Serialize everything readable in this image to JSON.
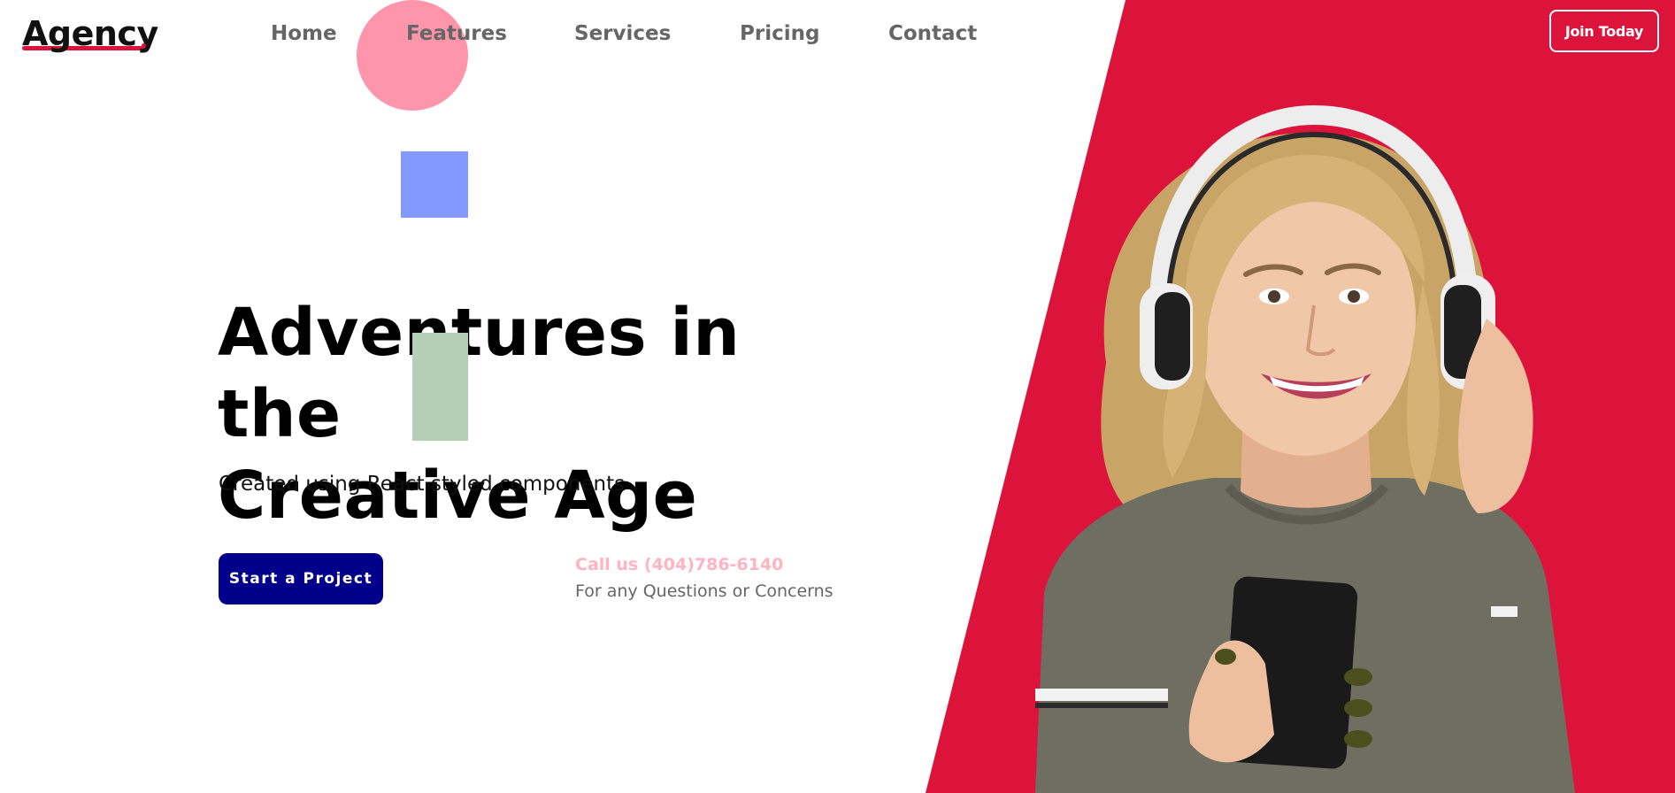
{
  "brand": {
    "logo": "Agency"
  },
  "nav": {
    "items": [
      {
        "label": "Home"
      },
      {
        "label": "Features"
      },
      {
        "label": "Services"
      },
      {
        "label": "Pricing"
      },
      {
        "label": "Contact"
      }
    ]
  },
  "header": {
    "join_label": "Join Today"
  },
  "hero": {
    "title_line1": "Adventures in the",
    "title_line2": "Creative Age",
    "subtitle": "Created using React styled components",
    "cta_label": "Start a Project",
    "call_text": "Call us (404)786-6140",
    "call_subtext": "For any Questions or Concerns"
  },
  "colors": {
    "accent_red": "#dc143c",
    "button_navy": "#00008b",
    "shape_pink": "#ff95ab",
    "shape_blue": "#8399ff",
    "shape_green": "#b4cfb6"
  },
  "icons": {
    "hero_image": "woman-with-headphones-image"
  }
}
